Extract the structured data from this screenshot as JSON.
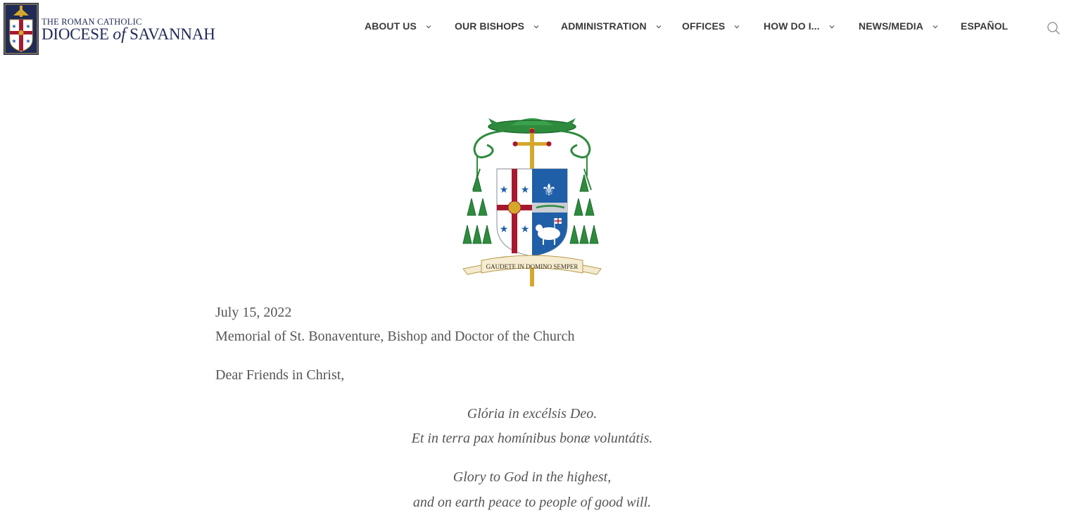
{
  "header": {
    "logo": {
      "line1": "THE ROMAN CATHOLIC",
      "line2_pre": "DIOCESE",
      "line2_of": "of",
      "line2_post": "SAVANNAH"
    },
    "nav": [
      {
        "label": "ABOUT US",
        "dropdown": true
      },
      {
        "label": "OUR BISHOPS",
        "dropdown": true
      },
      {
        "label": "ADMINISTRATION",
        "dropdown": true
      },
      {
        "label": "OFFICES",
        "dropdown": true
      },
      {
        "label": "HOW DO I...",
        "dropdown": true
      },
      {
        "label": "NEWS/MEDIA",
        "dropdown": true
      },
      {
        "label": "ESPAÑOL",
        "dropdown": false
      }
    ],
    "search_icon": "search-icon"
  },
  "coat_of_arms": {
    "motto": "GAUDETE IN DOMINO SEMPER"
  },
  "letter": {
    "date": "July 15, 2022",
    "occasion": "Memorial of St. Bonaventure, Bishop and Doctor of the Church",
    "salutation": "Dear Friends in Christ,",
    "latin": [
      "Glória in excélsis Deo.",
      "Et in terra pax homínibus bonæ voluntátis."
    ],
    "english": [
      "Glory to God in the highest,",
      "and on earth peace to people of good will."
    ]
  },
  "colors": {
    "navy": "#1f2a57",
    "nav_text": "#3a3a3a",
    "body_text": "#555555",
    "green": "#2e8b3e",
    "red": "#a6192e",
    "blue": "#1f5fa8",
    "gold": "#d4a82a"
  }
}
